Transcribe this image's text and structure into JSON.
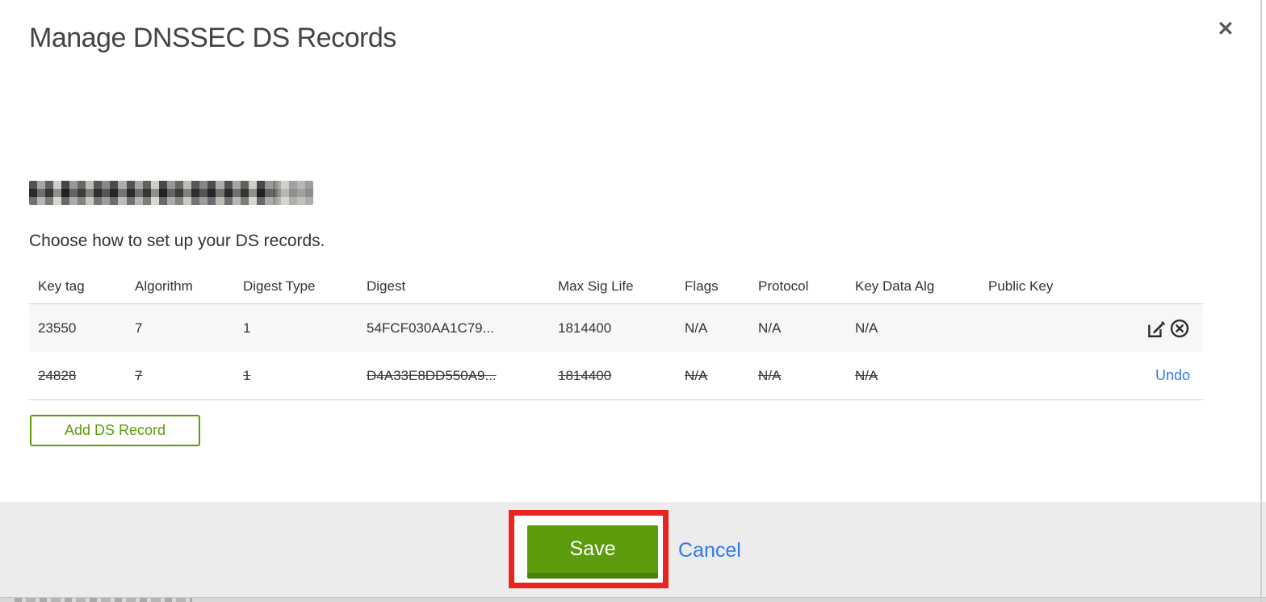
{
  "modal": {
    "title": "Manage DNSSEC DS Records",
    "subtitle": "Choose how to set up your DS records.",
    "close_glyph": "✕"
  },
  "table": {
    "columns": [
      "Key tag",
      "Algorithm",
      "Digest Type",
      "Digest",
      "Max Sig Life",
      "Flags",
      "Protocol",
      "Key Data Alg",
      "Public Key"
    ],
    "rows": [
      {
        "cells": [
          "23550",
          "7",
          "1",
          "54FCF030AA1C79...",
          "1814400",
          "N/A",
          "N/A",
          "N/A",
          ""
        ],
        "state": "normal"
      },
      {
        "cells": [
          "24828",
          "7",
          "1",
          "D4A33E8DD550A9...",
          "1814400",
          "N/A",
          "N/A",
          "N/A",
          ""
        ],
        "state": "deleted",
        "undo_label": "Undo"
      }
    ]
  },
  "buttons": {
    "add_ds_record": "Add DS Record",
    "save": "Save",
    "cancel": "Cancel"
  },
  "colors": {
    "accent_green": "#5c9b0c",
    "accent_green_dark": "#4e800f",
    "link_blue": "#2f79ef",
    "annotation_red": "#e8251f",
    "row_alt_bg": "#f7f7f7",
    "footer_bg": "#ececec"
  }
}
